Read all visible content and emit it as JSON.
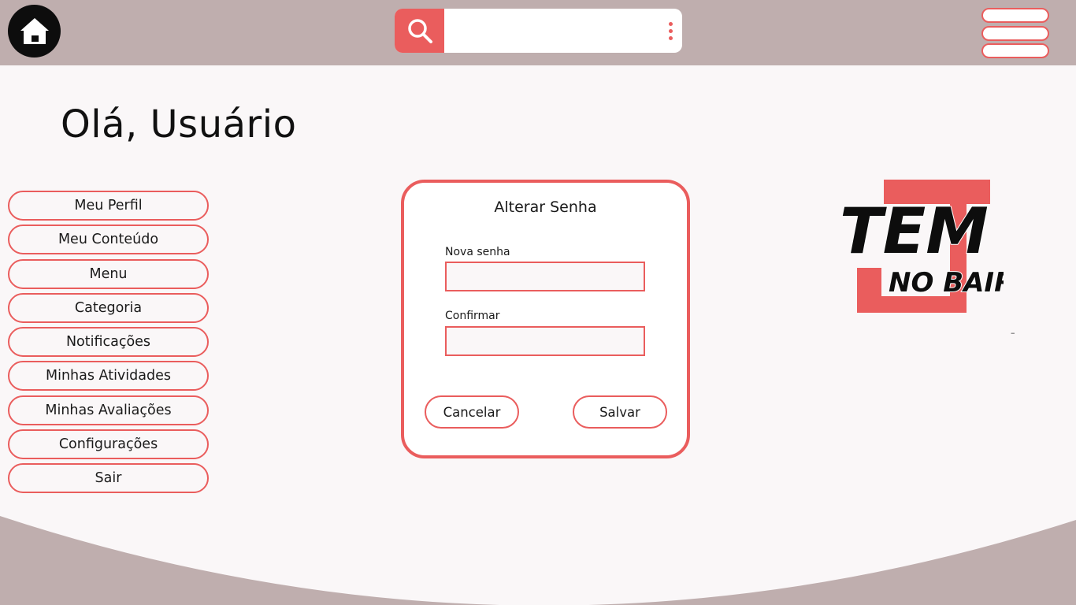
{
  "header": {
    "search": {
      "value": "",
      "placeholder": ""
    },
    "icons": {
      "home": "home-icon",
      "search": "search-icon",
      "more": "more-vertical-icon",
      "menu": "hamburger-menu-icon"
    }
  },
  "greeting": "Olá, Usuário",
  "sidebar": {
    "items": [
      {
        "label": "Meu Perfil"
      },
      {
        "label": "Meu Conteúdo"
      },
      {
        "label": "Menu"
      },
      {
        "label": "Categoria"
      },
      {
        "label": "Notificações"
      },
      {
        "label": "Minhas Atividades"
      },
      {
        "label": "Minhas Avaliações"
      },
      {
        "label": "Configurações"
      },
      {
        "label": "Sair"
      }
    ]
  },
  "password_card": {
    "title": "Alterar Senha",
    "new_password_label": "Nova senha",
    "new_password_value": "",
    "confirm_label": "Confirmar",
    "confirm_value": "",
    "cancel_label": "Cancelar",
    "save_label": "Salvar"
  },
  "logo": {
    "line1": "TEM",
    "line2": "NO BAIRRO"
  },
  "misc": {
    "dash": "–"
  },
  "colors": {
    "accent": "#ea5d5d",
    "header_bg": "#bfaeae",
    "page_bg": "#faf7f8",
    "dark": "#0d0d0d"
  }
}
